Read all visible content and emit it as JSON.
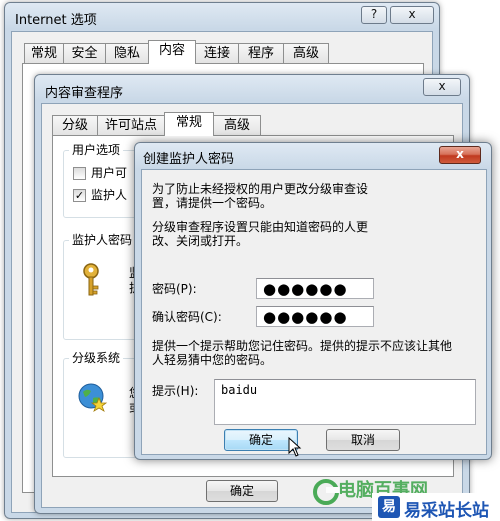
{
  "ie_options": {
    "title": "Internet 选项",
    "help_glyph": "?",
    "close_glyph": "x",
    "tabs": [
      "常规",
      "安全",
      "隐私",
      "内容",
      "连接",
      "程序",
      "高级"
    ],
    "active_tab": 3
  },
  "content_advisor": {
    "title": "内容审查程序",
    "close_glyph": "x",
    "tabs": [
      "分级",
      "许可站点",
      "常规",
      "高级"
    ],
    "active_tab": 2,
    "user_options_label": "用户选项",
    "checkbox_1_label": "用户可",
    "checkbox_2_label": "监护人",
    "checkbox_2_mark": "✓",
    "supervisor_label": "监护人密码",
    "supervisor_text_1": "监",
    "supervisor_text_2": "护",
    "rating_label": "分级系统",
    "rating_text_1": "您",
    "rating_text_2": "或",
    "ok_label": "确定"
  },
  "create_password": {
    "title": "创建监护人密码",
    "close_glyph": "x",
    "intro_line_1": "为了防止未经授权的用户更改分级审查设",
    "intro_line_2": "置，请提供一个密码。",
    "note_line_1": "分级审查程序设置只能由知道密码的人更",
    "note_line_2": "改、关闭或打开。",
    "password_label": "密码(P):",
    "password_value": "●●●●●●",
    "confirm_label": "确认密码(C):",
    "confirm_value": "●●●●●●",
    "hint_desc_line_1": "提供一个提示帮助您记住密码。提供的提示不应该让其他",
    "hint_desc_line_2": "人轻易猜中您的密码。",
    "hint_label": "提示(H):",
    "hint_value": "baidu",
    "ok_label": "确定",
    "cancel_label": "取消"
  },
  "watermark": {
    "left_text": "电脑百事网",
    "right_text": "易采站长站",
    "badge_glyph": "易"
  },
  "colors": {
    "frame_top": "#dfe9f3",
    "frame_bottom": "#c9d8e7",
    "dialog_face": "#f0f0f0",
    "close_red": "#c0391f",
    "default_button": "#bee6fd",
    "watermark_green": "#2e9e3d",
    "badge_blue": "#1e56b4"
  }
}
